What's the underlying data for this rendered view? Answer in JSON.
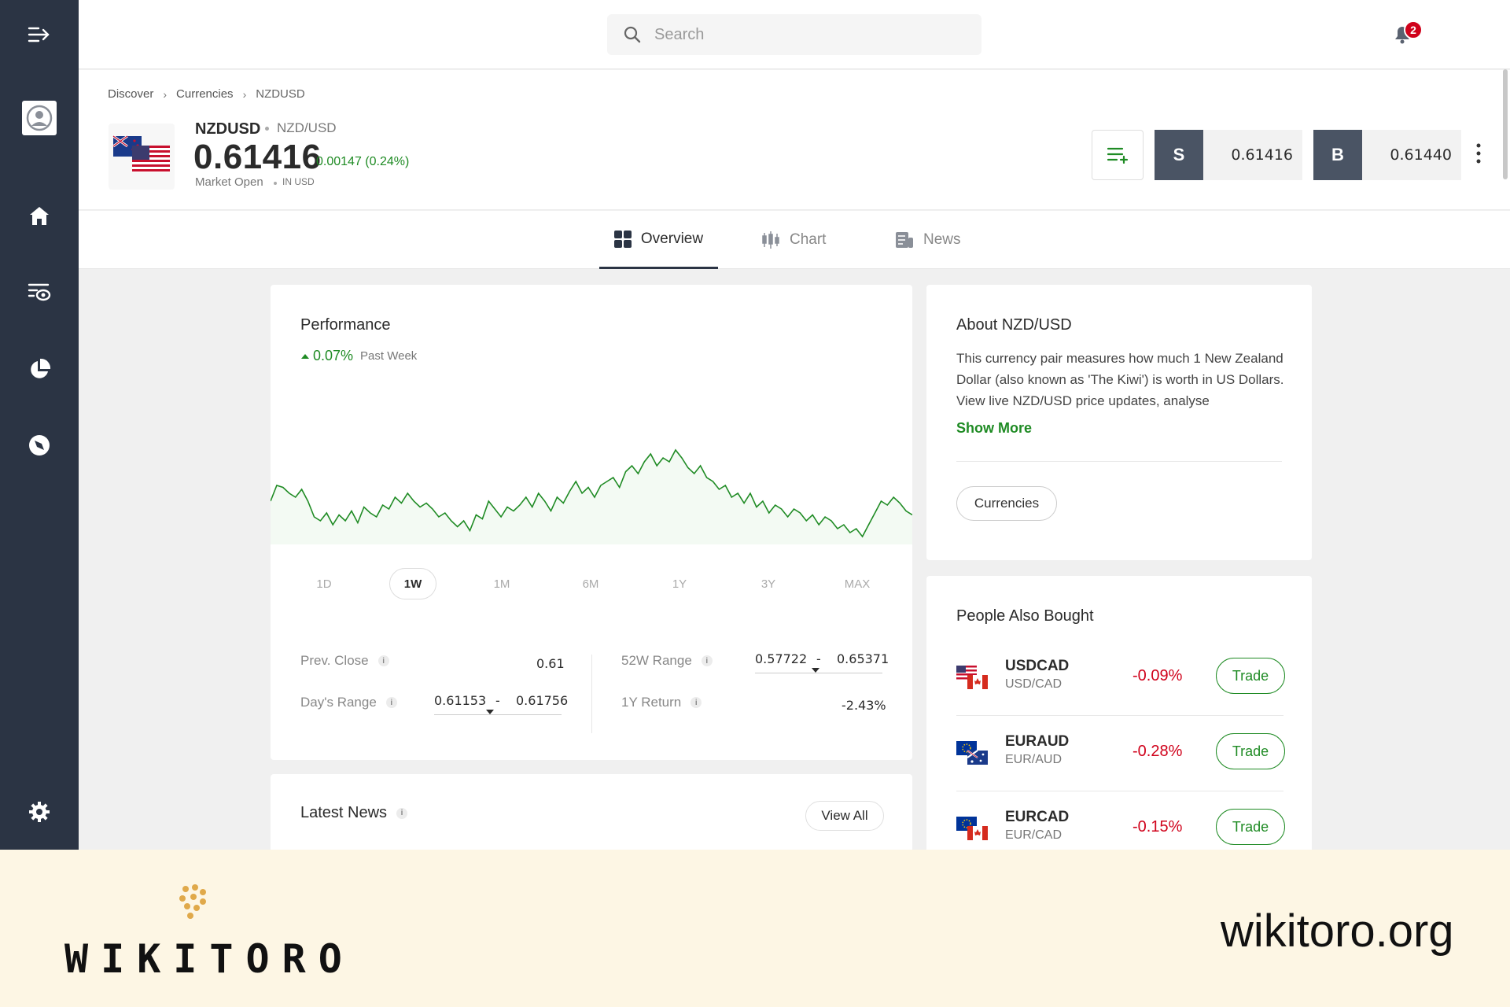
{
  "search": {
    "placeholder": "Search"
  },
  "notifications": {
    "count": "2"
  },
  "breadcrumb": {
    "items": [
      "Discover",
      "Currencies",
      "NZDUSD"
    ]
  },
  "instrument": {
    "symbol": "NZDUSD",
    "name": "NZD/USD",
    "price": "0.61416",
    "change": "0.00147 (0.24%)",
    "market_status": "Market Open",
    "currency": "IN USD"
  },
  "trade": {
    "sell_label": "S",
    "sell_price": "0.61416",
    "buy_label": "B",
    "buy_price": "0.61440"
  },
  "tabs": [
    {
      "label": "Overview",
      "icon": "grid-icon",
      "active": true
    },
    {
      "label": "Chart",
      "icon": "candlestick-icon",
      "active": false
    },
    {
      "label": "News",
      "icon": "news-icon",
      "active": false
    }
  ],
  "performance": {
    "title": "Performance",
    "change": "0.07%",
    "change_label": "Past Week",
    "periods": [
      "1D",
      "1W",
      "1M",
      "6M",
      "1Y",
      "3Y",
      "MAX"
    ],
    "active_period": "1W",
    "stats": {
      "prev_close_label": "Prev. Close",
      "prev_close": "0.61",
      "days_range_label": "Day's Range",
      "days_low": "0.61153",
      "days_high": "0.61756",
      "range_sep": "-",
      "w52_label": "52W Range",
      "w52_low": "0.57722",
      "w52_high": "0.65371",
      "return_label": "1Y Return",
      "return_value": "-2.43%"
    }
  },
  "chart_data": {
    "type": "line",
    "title": "",
    "xlabel": "",
    "ylabel": "",
    "color": "#1f8b24",
    "values": [
      48,
      56,
      55,
      52,
      50,
      54,
      48,
      40,
      38,
      42,
      36,
      41,
      38,
      43,
      37,
      45,
      42,
      40,
      46,
      44,
      50,
      47,
      52,
      48,
      45,
      47,
      44,
      40,
      42,
      38,
      35,
      38,
      33,
      41,
      39,
      48,
      44,
      40,
      45,
      43,
      46,
      50,
      45,
      52,
      48,
      43,
      50,
      47,
      53,
      58,
      52,
      55,
      50,
      56,
      58,
      60,
      55,
      63,
      66,
      62,
      68,
      72,
      66,
      70,
      68,
      74,
      70,
      65,
      62,
      66,
      60,
      58,
      54,
      56,
      50,
      52,
      47,
      52,
      45,
      48,
      42,
      46,
      44,
      40,
      44,
      42,
      38,
      41,
      36,
      40,
      38,
      34,
      36,
      32,
      34,
      30,
      36,
      42,
      48,
      46,
      50,
      47,
      43,
      41
    ]
  },
  "about": {
    "title": "About NZD/USD",
    "text": "This currency pair measures how much 1 New Zealand Dollar (also known as 'The Kiwi') is worth in US Dollars. View live NZD/USD price updates, analyse",
    "show_more": "Show More",
    "tag": "Currencies"
  },
  "people_also_bought": {
    "title": "People Also Bought",
    "trade_label": "Trade",
    "items": [
      {
        "symbol": "USDCAD",
        "name": "USD/CAD",
        "change": "-0.09%"
      },
      {
        "symbol": "EURAUD",
        "name": "EUR/AUD",
        "change": "-0.28%"
      },
      {
        "symbol": "EURCAD",
        "name": "EUR/CAD",
        "change": "-0.15%"
      }
    ]
  },
  "news": {
    "title": "Latest News",
    "view_all": "View All"
  },
  "watermark": {
    "logo": "WIKITORO",
    "url": "wikitoro.org"
  }
}
